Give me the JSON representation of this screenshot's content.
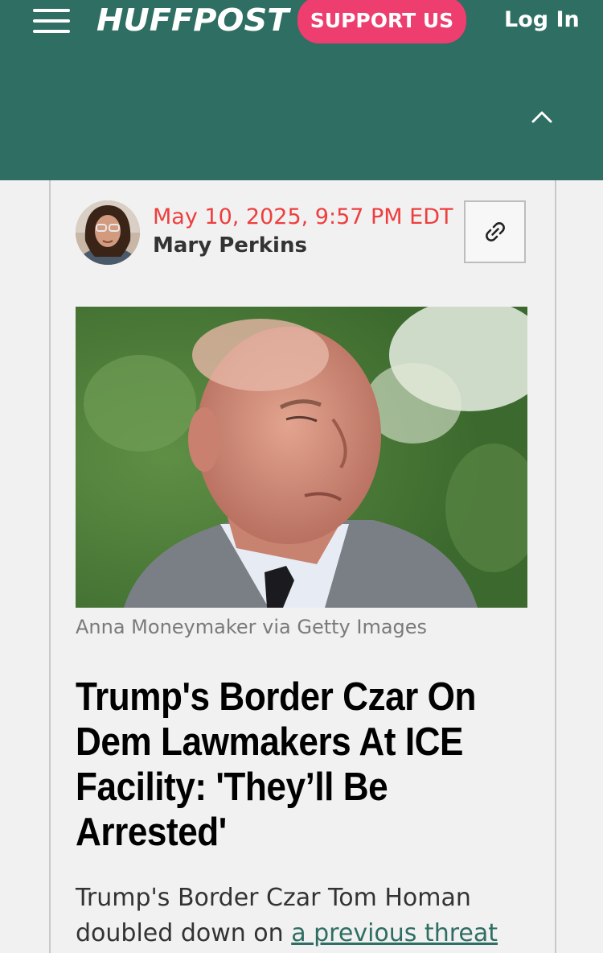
{
  "header": {
    "logo": "HUFFPOST",
    "support_label": "SUPPORT US",
    "login_label": "Log In",
    "background_color": "#2f6e62",
    "support_color": "#ed3e6f"
  },
  "article": {
    "date": "May 10, 2025, 9:57 PM EDT",
    "author": "Mary Perkins",
    "image_caption": "Anna Moneymaker via Getty Images",
    "headline": "Trump's Border Czar On Dem Lawmakers At ICE Facility: 'They’ll Be Arrested'",
    "body_start": "Trump's Border Czar Tom Homan doubled down on ",
    "body_link": "a previous threat",
    "date_color": "#ee3e3e"
  },
  "icons": {
    "menu": "hamburger-menu-icon",
    "collapse": "chevron-up-icon",
    "share_link": "link-icon"
  }
}
